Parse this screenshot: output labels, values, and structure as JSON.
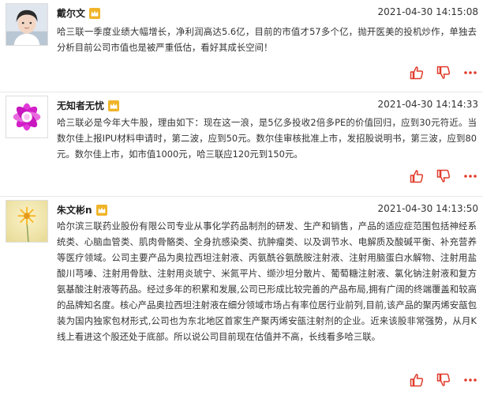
{
  "colors": {
    "accent": "#e03b2b",
    "vip_badge": "#f0b429",
    "divider": "#e8e8e8"
  },
  "posts": [
    {
      "username": "戴尔文",
      "timestamp": "2021-04-30 14:15:08",
      "content": "哈三联一季度业绩大幅增长，净利润高达5.6亿，目前的市值才57多个亿，抛开医美的投机炒作，单独去分析目前公司市值也是被严重低估，看好其成长空间！",
      "avatar_icon": "person-avatar-icon",
      "badge_icon": "crown-vip-icon",
      "action_icons": [
        "thumbs-up-icon",
        "thumbs-down-icon",
        "more-icon"
      ]
    },
    {
      "username": "无知者无忧",
      "timestamp": "2021-04-30 14:14:33",
      "content": "哈三联必是今年大牛股，理由如下：现在这一浪，是5亿多投收2倍多PE的价值回归，应到30元符近。当数尔佳上报IPU材料申请时，第二波，应到50元。数尔佳审核批准上市，发招股说明书，第三波，应到80元。数尔佳上市，如市值1000元，哈三联应120元到150元。",
      "avatar_icon": "flower-avatar-icon",
      "badge_icon": "crown-vip-icon",
      "action_icons": [
        "thumbs-up-icon",
        "thumbs-down-icon",
        "more-icon"
      ]
    },
    {
      "username": "朱文彬n",
      "timestamp": "2021-04-30 14:13:50",
      "content": "哈尔滨三联药业股份有限公司专业从事化学药品制剂的研发、生产和销售，产品的适应症范围包括神经系统类、心脑血管类、肌肉骨骼类、全身抗感染类、抗肿瘤类、以及调节水、电解质及酸碱平衡、补充营养等医疗领域。公司主要产品为奥拉西坦注射液、丙氨酰谷氨酰胺注射液、注射用脑蛋白水解物、注射用盐酸川芎嗪、注射用骨肽、注射用炎琥宁、米氮平片、缬沙坦分散片、葡萄糖注射液、氯化钠注射液和复方氨基酸注射液等药品。经过多年的积累和发展,公司已形成比较完善的产品布局,拥有广阔的终端覆盖和较高的品牌知名度。核心产品奥拉西坦注射液在细分领域市场占有率位居行业前列,目前,该产品的聚丙烯安瓿包装为国内独家包材形式,公司也为东北地区首家生产聚丙烯安瓿注射剂的企业。近来该股非常强势，从月K线上看进这个股还处于底部。所以说公司目前现在估值并不高，长线看多哈三联。",
      "avatar_icon": "dandelion-avatar-icon",
      "badge_icon": "crown-vip-icon",
      "action_icons": [
        "thumbs-up-icon",
        "thumbs-down-icon",
        "more-icon"
      ]
    }
  ]
}
